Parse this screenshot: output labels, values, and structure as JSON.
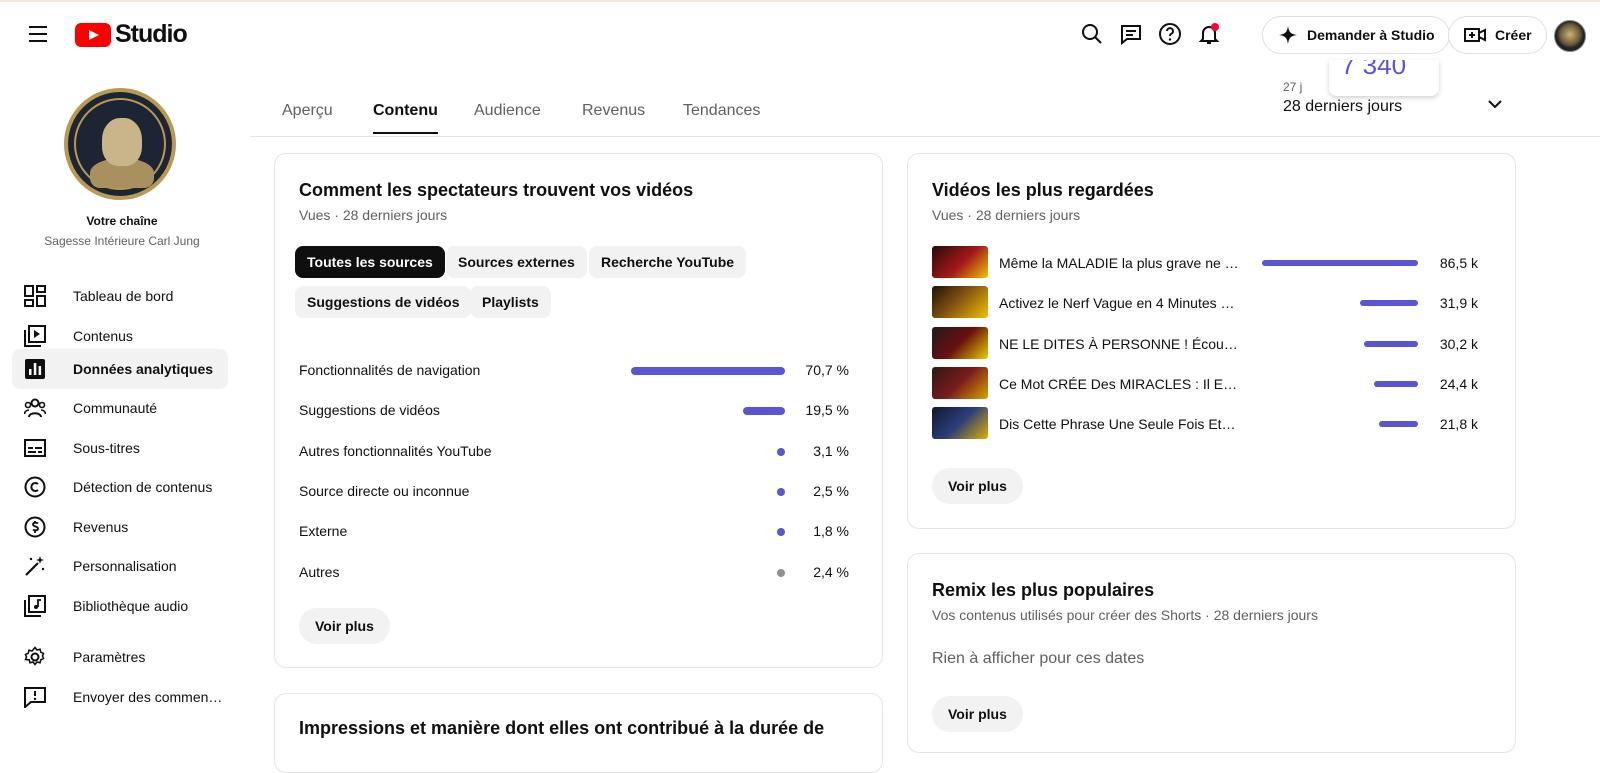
{
  "header": {
    "logo_text": "Studio",
    "ask_label": "Demander à Studio",
    "create_label": "Créer"
  },
  "sidebar": {
    "channel_label": "Votre chaîne",
    "channel_name": "Sagesse Intérieure Carl Jung",
    "items": [
      {
        "label": "Tableau de bord",
        "icon": "dashboard-icon"
      },
      {
        "label": "Contenus",
        "icon": "content-icon"
      },
      {
        "label": "Données analytiques",
        "icon": "analytics-icon",
        "active": true
      },
      {
        "label": "Communauté",
        "icon": "community-icon"
      },
      {
        "label": "Sous-titres",
        "icon": "subtitles-icon"
      },
      {
        "label": "Détection de contenus",
        "icon": "copyright-icon"
      },
      {
        "label": "Revenus",
        "icon": "revenue-icon"
      },
      {
        "label": "Personnalisation",
        "icon": "customization-icon"
      },
      {
        "label": "Bibliothèque audio",
        "icon": "audio-library-icon"
      },
      {
        "label": "Paramètres",
        "icon": "settings-icon"
      },
      {
        "label": "Envoyer des commen…",
        "icon": "feedback-icon"
      }
    ]
  },
  "tabs": [
    "Aperçu",
    "Contenu",
    "Audience",
    "Revenus",
    "Tendances"
  ],
  "active_tab": "Contenu",
  "period": {
    "float_value": "7 340",
    "small_label": "27 j",
    "label": "28 derniers jours"
  },
  "traffic_card": {
    "title": "Comment les spectateurs trouvent vos vidéos",
    "subtitle": "Vues · 28 derniers jours",
    "chips": [
      "Toutes les sources",
      "Sources externes",
      "Recherche YouTube",
      "Suggestions de vidéos",
      "Playlists"
    ],
    "active_chip": "Toutes les sources",
    "rows": [
      {
        "label": "Fonctionnalités de navigation",
        "value": "70,7 %",
        "share": 0.707,
        "color": "#5b55d6"
      },
      {
        "label": "Suggestions de vidéos",
        "value": "19,5 %",
        "share": 0.195,
        "color": "#5b55d6"
      },
      {
        "label": "Autres fonctionnalités YouTube",
        "value": "3,1 %",
        "share": 0.031,
        "color": "#5b55d6"
      },
      {
        "label": "Source directe ou inconnue",
        "value": "2,5 %",
        "share": 0.025,
        "color": "#5b55d6"
      },
      {
        "label": "Externe",
        "value": "1,8 %",
        "share": 0.018,
        "color": "#5b55d6"
      },
      {
        "label": "Autres",
        "value": "2,4 %",
        "share": 0.024,
        "color": "#909090"
      }
    ],
    "more_label": "Voir plus"
  },
  "impressions_card": {
    "title": "Impressions et manière dont elles ont contribué à la durée de"
  },
  "top_videos_card": {
    "title": "Vidéos les plus regardées",
    "subtitle": "Vues · 28 derniers jours",
    "videos": [
      {
        "title": "Même la MALADIE la plus grave ne ré…",
        "views": "86,5 k",
        "share": 1.0
      },
      {
        "title": "Activez le Nerf Vague en 4 Minutes et…",
        "views": "31,9 k",
        "share": 0.369
      },
      {
        "title": "NE LE DITES À PERSONNE ! Écoutez …",
        "views": "30,2 k",
        "share": 0.349
      },
      {
        "title": "Ce Mot CRÉE Des MIRACLES : Il Est L…",
        "views": "24,4 k",
        "share": 0.282
      },
      {
        "title": "Dis Cette Phrase Une Seule Fois Et L'…",
        "views": "21,8 k",
        "share": 0.252
      }
    ],
    "more_label": "Voir plus"
  },
  "remix_card": {
    "title": "Remix les plus populaires",
    "subtitle": "Vos contenus utilisés pour créer des Shorts · 28 derniers jours",
    "empty_text": "Rien à afficher pour ces dates",
    "more_label": "Voir plus"
  },
  "colors": {
    "accent": "#5b55d6",
    "brand": "#ff0000",
    "notification": "#ff0033"
  }
}
